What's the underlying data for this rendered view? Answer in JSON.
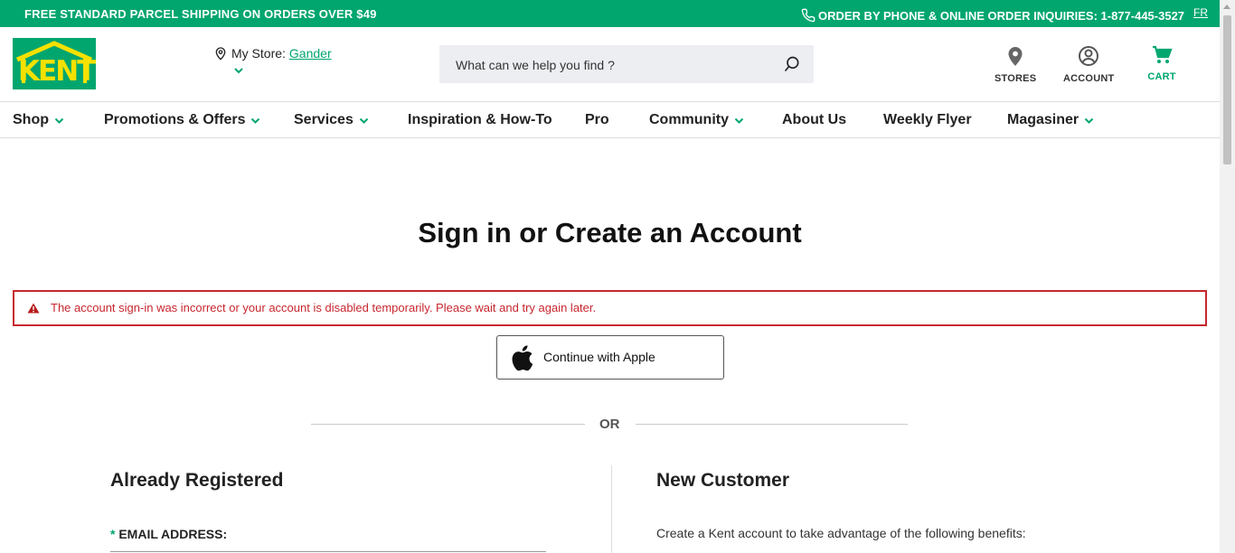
{
  "topbar": {
    "promo": "FREE STANDARD PARCEL SHIPPING ON ORDERS OVER $49",
    "phone": "ORDER BY PHONE & ONLINE ORDER INQUIRIES: 1-877-445-3527",
    "lang": "FR"
  },
  "header": {
    "logo_text": "KENT",
    "store_label": "My Store:",
    "store_name": "Gander",
    "search_placeholder": "What can we help you find ?",
    "stores_label": "STORES",
    "account_label": "ACCOUNT",
    "cart_label": "CART"
  },
  "nav": {
    "items": [
      {
        "label": "Shop",
        "has_menu": true
      },
      {
        "label": "Promotions & Offers",
        "has_menu": true
      },
      {
        "label": "Services",
        "has_menu": true
      },
      {
        "label": "Inspiration & How-To",
        "has_menu": false
      },
      {
        "label": "Pro",
        "has_menu": false
      },
      {
        "label": "Community",
        "has_menu": true
      },
      {
        "label": "About Us",
        "has_menu": false
      },
      {
        "label": "Weekly Flyer",
        "has_menu": false
      },
      {
        "label": "Magasiner",
        "has_menu": true
      }
    ]
  },
  "page": {
    "title": "Sign in or Create an Account",
    "error_message": "The account sign-in was incorrect or your account is disabled temporarily. Please wait and try again later.",
    "apple_button": "Continue with Apple",
    "or_text": "OR",
    "registered_heading": "Already Registered",
    "email_required_mark": "*",
    "email_label": "EMAIL ADDRESS:",
    "new_customer_heading": "New Customer",
    "benefits_text": "Create a Kent account to take advantage of the following benefits:"
  },
  "colors": {
    "brand_green": "#00a66e",
    "logo_yellow": "#f5e100",
    "error_red": "#c8262e"
  }
}
